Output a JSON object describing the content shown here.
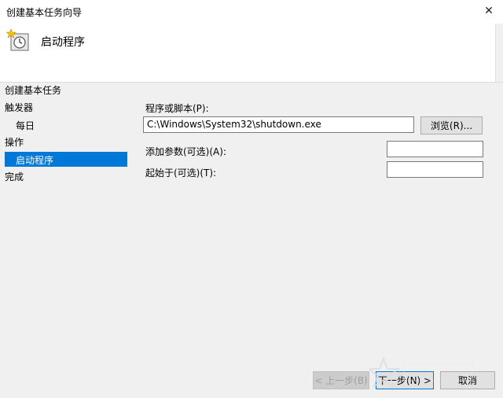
{
  "window": {
    "title": "创建基本任务向导"
  },
  "header": {
    "title": "启动程序"
  },
  "steps": [
    {
      "label": "创建基本任务"
    },
    {
      "label": "触发器"
    },
    {
      "label": "每日"
    },
    {
      "label": "操作"
    },
    {
      "label": "启动程序"
    },
    {
      "label": "完成"
    }
  ],
  "form": {
    "program_label": "程序或脚本(P):",
    "program_value": "C:\\Windows\\System32\\shutdown.exe",
    "browse_label": "浏览(R)...",
    "args_label": "添加参数(可选)(A):",
    "args_value": "",
    "startin_label": "起始于(可选)(T):",
    "startin_value": ""
  },
  "buttons": {
    "back": "< 上一步(B)",
    "next": "下一步(N) >",
    "cancel": "取消"
  },
  "colors": {
    "selected": "#0078d7",
    "panel": "#f0f0f0"
  },
  "icons": {
    "header": "clock-star-icon",
    "close": "close-icon"
  }
}
